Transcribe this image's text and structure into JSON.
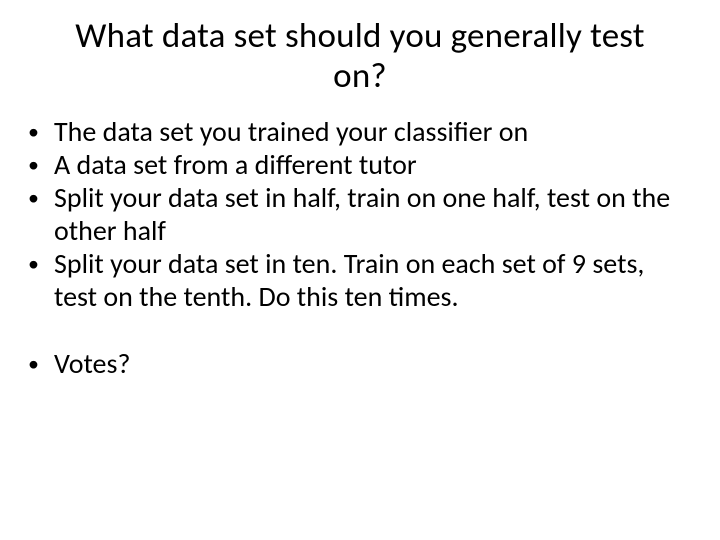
{
  "slide": {
    "title": "What data set should you generally test on?",
    "bullets": [
      "The data set you trained your classifier on",
      "A data set from a different tutor",
      "Split your data set in half, train on one half, test on the other half",
      "Split your data set in ten. Train on each set of 9 sets, test on the tenth. Do this ten times."
    ],
    "bullets2": [
      "Votes?"
    ]
  }
}
